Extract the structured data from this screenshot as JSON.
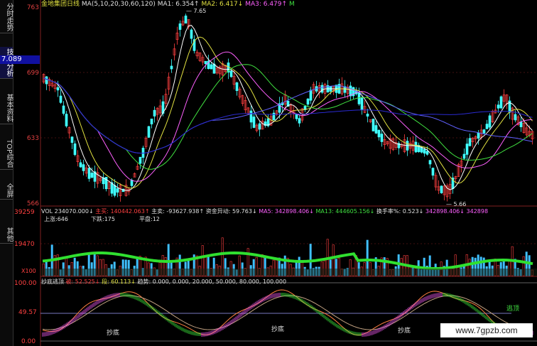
{
  "sidebar": {
    "tabs": [
      {
        "label": "分时走势"
      },
      {
        "label": "技术分析"
      },
      {
        "label": "基本资料"
      },
      {
        "label": "TOP综合"
      },
      {
        "label": "全屏"
      },
      {
        "label": "其他"
      }
    ]
  },
  "price_axis": {
    "top": "763",
    "current": "7.089",
    "l699": "699",
    "l633": "633",
    "l566": "566"
  },
  "header": {
    "title": "金地集团日线",
    "ma_params": "MA(5,10,20,30,60,120)",
    "ma1": "MA1: 6.354↑",
    "ma2": "MA2: 6.417↓",
    "ma3": "MA3: 6.479↑",
    "ma_tail": "M",
    "high_marker": "— 7.65",
    "low_marker": "— 5.66"
  },
  "volume_panel": {
    "axis_top": "39259",
    "axis_mid": "19470",
    "axis_bottom": "X100",
    "vol": "VOL 234070.000↓",
    "zhuyao": "主买: 140442.063↑",
    "zhumai": "主卖: -93627.938↑",
    "zijin": "资金异动: 59.763↓",
    "ma5": "MA5: 342898.406↓",
    "ma13": "MA13: 444605.156↓",
    "huanshou": "换手率%: 0.523↓",
    "extra1": "342898.406↓",
    "extra2": "342898",
    "shangzhang": "上涨:646",
    "xiadie": "下跌:175",
    "pingpan": "平盘:12"
  },
  "indicator_panel": {
    "axis_top": "100.00",
    "axis_mid": "49.57",
    "axis_bottom": "0.00",
    "name": "抄底逃顶",
    "hint": "被: 52.525↓",
    "duan": "段: 60.113↓",
    "qushi": "趋势: 0.000, 0.000, 20.000, 50.000, 80.000, 100.000",
    "chaodi_labels": [
      "抄底",
      "抄底",
      "抄底"
    ],
    "taoding": "逃顶"
  },
  "watermark": "www.7gpzb.com",
  "colors": {
    "up": "#ff4040",
    "down": "#40ffff",
    "ma_yellow": "#e0e040",
    "ma_pink": "#ff60ff",
    "ma_green": "#40e040",
    "ma_blue": "#4040ff",
    "grid": "#802020"
  }
}
